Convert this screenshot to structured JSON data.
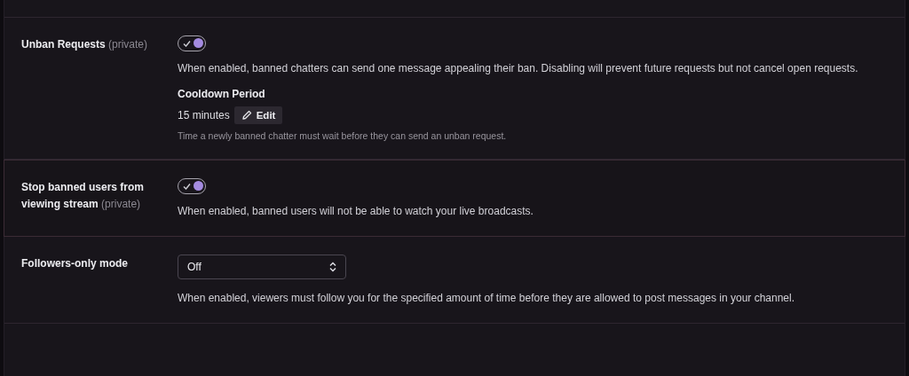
{
  "settings": [
    {
      "kind": "toggle",
      "label": "Unban Requests",
      "tag": "(private)",
      "on": true,
      "highlighted": false,
      "description": "When enabled, banned chatters can send one message appealing their ban. Disabling will prevent future requests but not cancel open requests.",
      "cooldown": {
        "title": "Cooldown Period",
        "value": "15 minutes",
        "edit_button": "Edit",
        "hint": "Time a newly banned chatter must wait before they can send an unban request."
      }
    },
    {
      "kind": "toggle",
      "label": "Stop banned users from viewing stream",
      "tag": "(private)",
      "on": true,
      "highlighted": true,
      "description": "When enabled, banned users will not be able to watch your live broadcasts."
    },
    {
      "kind": "select",
      "label": "Followers-only mode",
      "value": "Off",
      "highlighted": false,
      "description": "When enabled, viewers must follow you for the specified amount of time before they are allowed to post messages in your channel."
    }
  ]
}
